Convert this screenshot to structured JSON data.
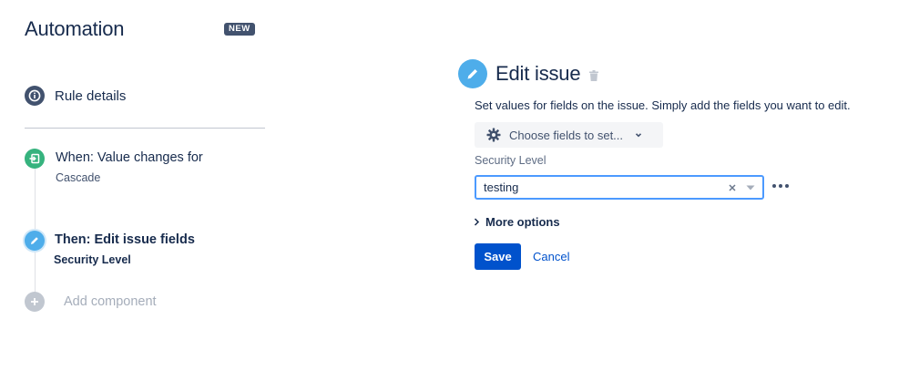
{
  "sidebar": {
    "title": "Automation",
    "badge": "NEW",
    "rule_details": {
      "label": "Rule details",
      "icon": "info-icon"
    },
    "trigger": {
      "title": "When: Value changes for",
      "subtitle": "Cascade",
      "icon": "trigger-icon",
      "color": "#36b37e"
    },
    "action": {
      "title": "Then: Edit issue fields",
      "subtitle": "Security Level",
      "icon": "pencil-icon",
      "color": "#4eadea"
    },
    "add_component": {
      "label": "Add component",
      "icon": "plus-icon"
    }
  },
  "editor": {
    "title": "Edit issue",
    "description": "Set values for fields on the issue. Simply add the fields you want to edit.",
    "choose_fields": {
      "label": "Choose fields to set...",
      "icon": "gear-icon"
    },
    "field": {
      "label": "Security Level",
      "value": "testing"
    },
    "more_options": "More options",
    "save_label": "Save",
    "cancel_label": "Cancel"
  },
  "colors": {
    "primary": "#0052cc",
    "text": "#172b4d",
    "focus_border": "#4c9aff",
    "badge_bg": "#42526e"
  }
}
